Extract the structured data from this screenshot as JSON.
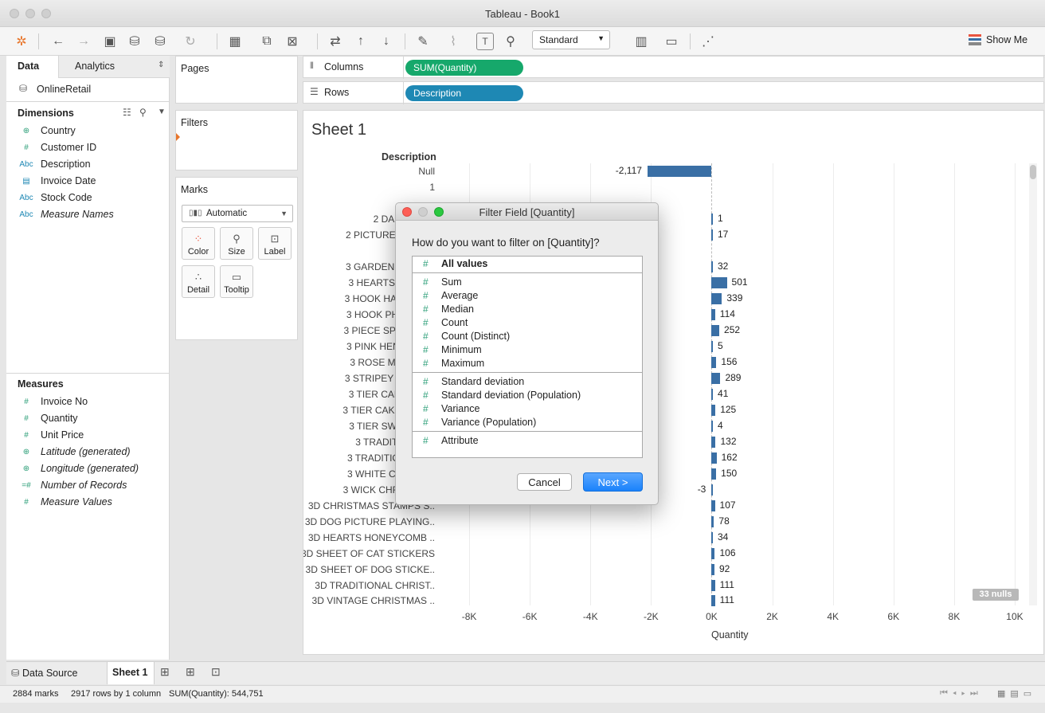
{
  "window": {
    "title": "Tableau - Book1"
  },
  "toolbar": {
    "view_size": "Standard",
    "show_me": "Show Me"
  },
  "left_pane": {
    "tab_data": "Data",
    "tab_analytics": "Analytics",
    "datasource": "OnlineRetail",
    "dimensions_title": "Dimensions",
    "dimensions": [
      {
        "type": "globe",
        "label": "Country"
      },
      {
        "type": "#",
        "label": "Customer ID"
      },
      {
        "type": "Abc",
        "label": "Description"
      },
      {
        "type": "date",
        "label": "Invoice Date"
      },
      {
        "type": "Abc",
        "label": "Stock Code"
      },
      {
        "type": "Abc",
        "label": "Measure Names"
      }
    ],
    "measures_title": "Measures",
    "measures": [
      {
        "type": "#",
        "label": "Invoice No"
      },
      {
        "type": "#",
        "label": "Quantity"
      },
      {
        "type": "#",
        "label": "Unit Price"
      },
      {
        "type": "globe",
        "label": "Latitude (generated)"
      },
      {
        "type": "globe",
        "label": "Longitude (generated)"
      },
      {
        "type": "=#",
        "label": "Number of Records"
      },
      {
        "type": "#",
        "label": "Measure Values"
      }
    ]
  },
  "cards": {
    "pages": "Pages",
    "filters": "Filters",
    "marks": "Marks",
    "mark_type": "Automatic",
    "buttons": {
      "color": "Color",
      "size": "Size",
      "label": "Label",
      "detail": "Detail",
      "tooltip": "Tooltip"
    }
  },
  "shelves": {
    "columns_label": "Columns",
    "columns_pill": "SUM(Quantity)",
    "rows_label": "Rows",
    "rows_pill": "Description"
  },
  "sheet": {
    "title": "Sheet 1",
    "row_header": "Description",
    "nulls_badge": "33 nulls"
  },
  "colors": {
    "bar": "#3a6fa5",
    "columns_pill": "#16a86b",
    "rows_pill": "#1e88b4",
    "next_button": "#1a82fb"
  },
  "chart_data": {
    "type": "bar",
    "orientation": "horizontal",
    "xlabel": "Quantity",
    "xlim": [
      -9000,
      10500
    ],
    "x_ticks": [
      "-8K",
      "-6K",
      "-4K",
      "-2K",
      "0K",
      "2K",
      "4K",
      "6K",
      "8K",
      "10K"
    ],
    "rows": [
      {
        "label": "Null",
        "value": -2117,
        "value_label": "-2,117"
      },
      {
        "label": "1",
        "value": null,
        "value_label": ""
      },
      {
        "label": "2 DAISIES HA",
        "value": 1,
        "value_label": "1"
      },
      {
        "label": "2 PICTURE BOOK E",
        "value": 17,
        "value_label": "17"
      },
      {
        "label": "3 GARDENIA MORR",
        "value": 32,
        "value_label": "32"
      },
      {
        "label": "3 HEARTS HANGIN",
        "value": 501,
        "value_label": "501"
      },
      {
        "label": "3 HOOK HANGER M",
        "value": 339,
        "value_label": "339"
      },
      {
        "label": "3 HOOK PHOTO SH",
        "value": 114,
        "value_label": "114"
      },
      {
        "label": "3 PIECE SPACEBOY",
        "value": 252,
        "value_label": "252"
      },
      {
        "label": "3 PINK HEN+CHICK",
        "value": 5,
        "value_label": "5"
      },
      {
        "label": "3 ROSE MORRIS B",
        "value": 156,
        "value_label": "156"
      },
      {
        "label": "3 STRIPEY MICE FE",
        "value": 289,
        "value_label": "289"
      },
      {
        "label": "3 TIER CAKE TIN G",
        "value": 41,
        "value_label": "41"
      },
      {
        "label": "3 TIER CAKE TIN RE",
        "value": 125,
        "value_label": "125"
      },
      {
        "label": "3 TIER SWEETHEA",
        "value": 4,
        "value_label": "4"
      },
      {
        "label": "3 TRADITIONAl BI",
        "value": 132,
        "value_label": "132"
      },
      {
        "label": "3 TRADITIONAL CO",
        "value": 162,
        "value_label": "162"
      },
      {
        "label": "3 WHITE CHOC MO",
        "value": 150,
        "value_label": "150"
      },
      {
        "label": "3 WICK CHRISTMAS",
        "value": -3,
        "value_label": "-3"
      },
      {
        "label": "3D CHRISTMAS STAMPS S..",
        "value": 107,
        "value_label": "107"
      },
      {
        "label": "3D DOG PICTURE PLAYING..",
        "value": 78,
        "value_label": "78"
      },
      {
        "label": "3D HEARTS  HONEYCOMB ..",
        "value": 34,
        "value_label": "34"
      },
      {
        "label": "3D SHEET OF CAT STICKERS",
        "value": 106,
        "value_label": "106"
      },
      {
        "label": "3D SHEET OF DOG STICKE..",
        "value": 92,
        "value_label": "92"
      },
      {
        "label": "3D TRADITIONAL CHRIST..",
        "value": 111,
        "value_label": "111"
      },
      {
        "label": "3D VINTAGE CHRISTMAS ..",
        "value": 111,
        "value_label": "111"
      }
    ]
  },
  "dialog": {
    "title": "Filter Field [Quantity]",
    "prompt": "How do you want to filter on [Quantity]?",
    "groups": [
      [
        "All values"
      ],
      [
        "Sum",
        "Average",
        "Median",
        "Count",
        "Count (Distinct)",
        "Minimum",
        "Maximum"
      ],
      [
        "Standard deviation",
        "Standard deviation (Population)",
        "Variance",
        "Variance (Population)"
      ],
      [
        "Attribute"
      ]
    ],
    "cancel": "Cancel",
    "next": "Next >"
  },
  "tabs": {
    "datasource": "Data Source",
    "sheet1": "Sheet 1"
  },
  "status": {
    "marks": "2884 marks",
    "rows": "2917 rows by 1 column",
    "sum": "SUM(Quantity): 544,751"
  }
}
